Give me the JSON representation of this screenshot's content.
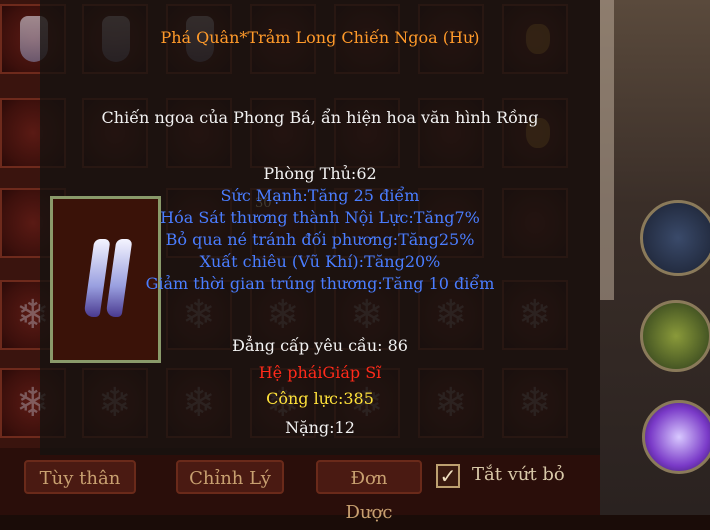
{
  "item": {
    "name": "Phá Quân*Trảm Long Chiến Ngoa (Hư)",
    "description": "Chiến ngoa của Phong Bá, ẩn hiện hoa văn hình Rồng",
    "defense": "Phòng Thủ:62",
    "attributes": [
      "Sức Mạnh:Tăng 25 điểm",
      "Hóa Sát thương thành Nội Lực:Tăng7%",
      "Bỏ qua né tránh đối phương:Tăng25%",
      "Xuất chiêu (Vũ Khí):Tăng20%",
      "Giảm thời gian trúng thương:Tăng 10 điểm"
    ],
    "level_requirement": "Đẳng cấp yêu cầu: 86",
    "faction": "Hệ pháiGiáp Sĩ",
    "power": "Công lực:385",
    "weight": "Nặng:12"
  },
  "inventory": {
    "slot_badge": "30",
    "buttons": {
      "tuy_than": "Tùy thân",
      "chinh_ly": "Chỉnh Lý",
      "don_duoc": "Đơn Dược"
    },
    "discard_checkbox": {
      "label": "Tắt vứt bỏ",
      "checked": true
    }
  },
  "colors": {
    "name": "#ff9a2a",
    "attribute": "#4a7dff",
    "faction": "#ff2a1a",
    "power": "#ffe23a",
    "text": "#f2f2f2"
  }
}
